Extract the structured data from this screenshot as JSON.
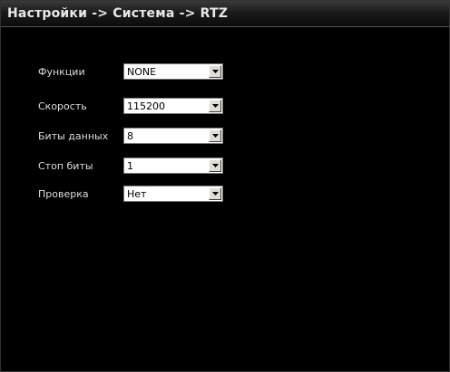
{
  "window": {
    "title": "Настройки -> Система -> RTZ"
  },
  "settings": [
    {
      "label": "Функции",
      "value": "NONE"
    },
    {
      "label": "Скорость",
      "value": "115200"
    },
    {
      "label": "Биты данных",
      "value": "8"
    },
    {
      "label": "Стоп биты",
      "value": "1"
    },
    {
      "label": "Проверка",
      "value": "Нет"
    }
  ],
  "icons": {
    "dropdown": "chevron-down-icon"
  },
  "colors": {
    "background": "#000000",
    "label_text": "#dddddd",
    "title_text": "#e8e8e8",
    "field_background": "#ffffff"
  }
}
